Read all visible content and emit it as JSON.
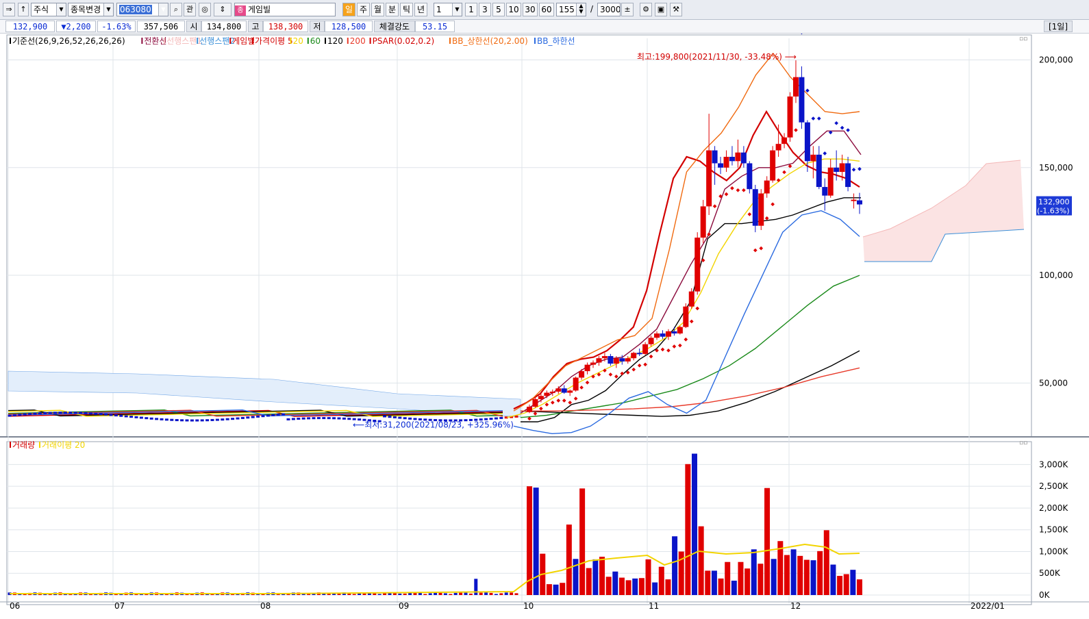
{
  "toolbar": {
    "market": "주식",
    "change_item": "종목변경",
    "code": "063080",
    "relation": "관",
    "stock_name": "게임빌",
    "periods": [
      "일",
      "주",
      "월",
      "분",
      "틱",
      "년"
    ],
    "active_period": "일",
    "interval": "1",
    "quick_intervals": [
      "1",
      "3",
      "5",
      "10",
      "30",
      "60"
    ],
    "count": "155",
    "total": "3000",
    "slash": "/"
  },
  "quote": {
    "price": "132,900",
    "change": "▼2,200",
    "change_pct": "-1.63%",
    "volume": "357,506",
    "open_label": "시",
    "open": "134,800",
    "high_label": "고",
    "high": "138,300",
    "low_label": "저",
    "low": "128,500",
    "strength_label": "체결강도",
    "strength": "53.15",
    "period_tag": "[1일]"
  },
  "legend_price": [
    {
      "text": "기준선(26,9,26,52,26,26,26)",
      "color": "#000000"
    },
    {
      "text": "전환선",
      "color": "#8b0a3c"
    },
    {
      "text": "선행스팬1",
      "color": "#f4b8b8"
    },
    {
      "text": "선행스팬2",
      "color": "#3a8fd8"
    },
    {
      "text": "게임빌",
      "color": "#d30000"
    },
    {
      "text": "가격이평 5",
      "color": "#d30000"
    },
    {
      "text": "20",
      "color": "#f2d400"
    },
    {
      "text": "60",
      "color": "#1a8a1a"
    },
    {
      "text": "120",
      "color": "#000000"
    },
    {
      "text": "200",
      "color": "#e83a2a"
    },
    {
      "text": "PSAR(0.02,0.2)",
      "color": "#d30000"
    },
    {
      "text": "BB_상한선(20,2.00)",
      "color": "#f06a10"
    },
    {
      "text": "BB_하한선",
      "color": "#2a6ae0"
    }
  ],
  "legend_volume": [
    {
      "text": "거래량",
      "color": "#d30000"
    },
    {
      "text": "거래이평 20",
      "color": "#f2d400"
    }
  ],
  "colors": {
    "up": "#e00000",
    "down": "#0a14c8",
    "grid": "#dfe4ea"
  },
  "chart_data": [
    {
      "type": "candlestick",
      "title": "게임빌",
      "x_ticks": [
        "06",
        "07",
        "08",
        "09",
        "10",
        "11",
        "12",
        "2022/01"
      ],
      "y_ticks": [
        "200,000",
        "150,000",
        "100,000",
        "50,000"
      ],
      "ylim": [
        25000,
        210000
      ],
      "current_price_label": [
        "132,900",
        "(-1.63%)"
      ],
      "annotations": [
        {
          "text": "최고:199,800(2021/11/30, -33.48%)",
          "price": 199800
        },
        {
          "text": "최저:31,200(2021/08/23, +325.96%)",
          "price": 31200
        }
      ],
      "candles_ohlc_recent": [
        [
          36500,
          40000,
          36000,
          39000
        ],
        [
          39000,
          43500,
          38500,
          42500
        ],
        [
          42500,
          45000,
          41000,
          44000
        ],
        [
          44000,
          46500,
          43000,
          45500
        ],
        [
          45500,
          47000,
          44000,
          46000
        ],
        [
          46000,
          48500,
          45000,
          47500
        ],
        [
          47500,
          49000,
          45000,
          45500
        ],
        [
          45500,
          47000,
          44000,
          46500
        ],
        [
          46500,
          53000,
          46000,
          52500
        ],
        [
          52500,
          56500,
          51500,
          55500
        ],
        [
          55500,
          59500,
          54000,
          58500
        ],
        [
          58500,
          60500,
          57000,
          59500
        ],
        [
          59500,
          62500,
          58000,
          61500
        ],
        [
          61500,
          64000,
          60000,
          62500
        ],
        [
          62500,
          63500,
          58000,
          59000
        ],
        [
          59000,
          62500,
          57000,
          61500
        ],
        [
          61500,
          63000,
          58500,
          60000
        ],
        [
          60000,
          62500,
          59000,
          61500
        ],
        [
          61500,
          64500,
          60500,
          64000
        ],
        [
          64000,
          66000,
          62500,
          63500
        ],
        [
          63500,
          69000,
          63000,
          68000
        ],
        [
          68000,
          72000,
          67000,
          71000
        ],
        [
          71000,
          74000,
          70000,
          73000
        ],
        [
          73000,
          74500,
          70500,
          71500
        ],
        [
          71500,
          75000,
          70000,
          74000
        ],
        [
          74000,
          76000,
          72000,
          73000
        ],
        [
          73000,
          76500,
          72500,
          76000
        ],
        [
          76000,
          87000,
          75500,
          85500
        ],
        [
          85500,
          94000,
          84500,
          92500
        ],
        [
          92500,
          120000,
          91000,
          117500
        ],
        [
          117500,
          135000,
          115000,
          132000
        ],
        [
          132000,
          175000,
          128000,
          158000
        ],
        [
          158000,
          160000,
          142000,
          152000
        ],
        [
          152000,
          155000,
          147000,
          150000
        ],
        [
          150000,
          158000,
          148000,
          155000
        ],
        [
          155000,
          160000,
          151000,
          153000
        ],
        [
          153000,
          163000,
          150000,
          157000
        ],
        [
          157000,
          160000,
          150000,
          152000
        ],
        [
          152000,
          153000,
          138000,
          140000
        ],
        [
          140000,
          142000,
          120000,
          123000
        ],
        [
          123000,
          140000,
          121000,
          138000
        ],
        [
          138000,
          146000,
          136000,
          144000
        ],
        [
          144000,
          160000,
          143000,
          158000
        ],
        [
          158000,
          170000,
          155000,
          161000
        ],
        [
          161000,
          166000,
          159000,
          164000
        ],
        [
          164000,
          185000,
          162000,
          183000
        ],
        [
          183000,
          199800,
          180000,
          192000
        ],
        [
          192000,
          197000,
          168000,
          171000
        ],
        [
          171000,
          172000,
          148000,
          153000
        ],
        [
          153000,
          160000,
          145000,
          156000
        ],
        [
          156000,
          160000,
          140000,
          141000
        ],
        [
          141000,
          145000,
          130000,
          137000
        ],
        [
          137000,
          154000,
          136000,
          150000
        ],
        [
          150000,
          158000,
          144000,
          148000
        ],
        [
          148000,
          156000,
          144000,
          152000
        ],
        [
          152000,
          155000,
          139000,
          141000
        ],
        [
          135100,
          138000,
          131000,
          135100
        ],
        [
          134800,
          138300,
          128500,
          132900
        ]
      ],
      "series": [
        {
          "name": "기준선",
          "values": [
            32000,
            32000,
            34000,
            40000,
            42000,
            46500,
            54000,
            61000,
            66000,
            75000,
            88000,
            117000,
            124000,
            124000,
            125000,
            126000,
            128000,
            131000,
            134000,
            136000,
            136000
          ]
        },
        {
          "name": "전환선",
          "values": [
            36000,
            41000,
            46000,
            53000,
            58000,
            61000,
            62000,
            68000,
            75000,
            90000,
            105000,
            118000,
            140000,
            146000,
            150000,
            150000,
            152000,
            160000,
            167000,
            167000,
            156000
          ]
        },
        {
          "name": "가격이평 5",
          "values": [
            38000,
            41000,
            45000,
            53000,
            59000,
            61000,
            62000,
            65000,
            70000,
            76000,
            93000,
            120000,
            145000,
            155000,
            153000,
            148000,
            144000,
            150000,
            165000,
            176000,
            166000,
            157000,
            151000,
            148000,
            147000,
            145000,
            141000
          ]
        },
        {
          "name": "20",
          "values": [
            34000,
            36000,
            40000,
            45000,
            50000,
            54000,
            58000,
            62000,
            66000,
            71000,
            78000,
            92000,
            110000,
            123000,
            134000,
            141000,
            147000,
            152000,
            154000,
            154000,
            153000
          ]
        },
        {
          "name": "60",
          "values": [
            34000,
            35000,
            37000,
            39000,
            41000,
            44000,
            47000,
            52000,
            58000,
            66000,
            76000,
            86000,
            95000,
            100000
          ]
        },
        {
          "name": "120",
          "values": [
            37000,
            36500,
            36000,
            35500,
            35000,
            34500,
            35000,
            37000,
            41000,
            46000,
            52000,
            58000,
            65000
          ]
        },
        {
          "name": "200",
          "values": [
            37000,
            37000,
            37500,
            38000,
            39000,
            41000,
            44000,
            48000,
            53000,
            57000
          ]
        },
        {
          "name": "BB_상한선",
          "values": [
            37000,
            42000,
            50000,
            58000,
            62000,
            66000,
            70000,
            72000,
            80000,
            112000,
            148000,
            158000,
            166000,
            178000,
            193000,
            203000,
            192000,
            184000,
            176000,
            175000,
            176000
          ]
        },
        {
          "name": "BB_하한선",
          "values": [
            30000,
            28000,
            26500,
            27000,
            30000,
            36000,
            43000,
            46000,
            40000,
            36000,
            42000,
            62000,
            82000,
            101000,
            120000,
            128000,
            130000,
            126000,
            118000
          ]
        }
      ]
    },
    {
      "type": "bar",
      "title": "거래량",
      "y_ticks": [
        "3,000K",
        "2,500K",
        "2,000K",
        "1,500K",
        "1,000K",
        "500K",
        "0K"
      ],
      "ylim": [
        0,
        3400
      ],
      "values_k_recent": [
        2500,
        2470,
        950,
        250,
        240,
        280,
        1620,
        830,
        2450,
        620,
        820,
        880,
        420,
        540,
        400,
        340,
        380,
        390,
        820,
        290,
        650,
        360,
        1350,
        1000,
        3010,
        3250,
        1580,
        560,
        560,
        380,
        760,
        330,
        760,
        610,
        1050,
        720,
        2460,
        830,
        1240,
        920,
        1050,
        900,
        810,
        800,
        1010,
        1490,
        700,
        440,
        480,
        580,
        360
      ]
    }
  ]
}
